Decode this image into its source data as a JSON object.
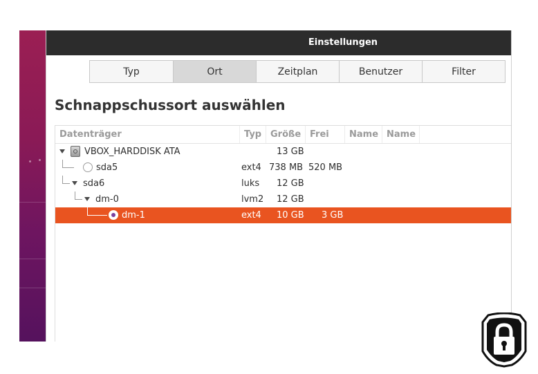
{
  "window": {
    "title": "Einstellungen"
  },
  "tabs": [
    {
      "label": "Typ",
      "active": false
    },
    {
      "label": "Ort",
      "active": true
    },
    {
      "label": "Zeitplan",
      "active": false
    },
    {
      "label": "Benutzer",
      "active": false
    },
    {
      "label": "Filter",
      "active": false
    }
  ],
  "section": {
    "heading": "Schnappschussort auswählen"
  },
  "table": {
    "columns": [
      "Datenträger",
      "Typ",
      "Größe",
      "Frei",
      "Name",
      "Name"
    ],
    "rows": [
      {
        "name": "VBOX_HARDDISK ATA",
        "icon": "harddisk-icon",
        "type": "",
        "size": "13 GB",
        "free": "",
        "expanded": true
      },
      {
        "name": "sda5",
        "icon": "radio",
        "type": "ext4",
        "size": "738 MB",
        "free": "520 MB",
        "selected": false
      },
      {
        "name": "sda6",
        "icon": "none",
        "type": "luks",
        "size": "12 GB",
        "free": "",
        "expanded": true
      },
      {
        "name": "dm-0",
        "icon": "none",
        "type": "lvm2",
        "size": "12 GB",
        "free": "",
        "expanded": true
      },
      {
        "name": "dm-1",
        "icon": "radio",
        "type": "ext4",
        "size": "10 GB",
        "free": "3 GB",
        "selected": true
      }
    ]
  },
  "colors": {
    "accent": "#e95420",
    "titlebar": "#2c2c2c",
    "radio_dot": "#7a3fa0"
  },
  "icons": {
    "badge": "shield-lock-icon"
  }
}
